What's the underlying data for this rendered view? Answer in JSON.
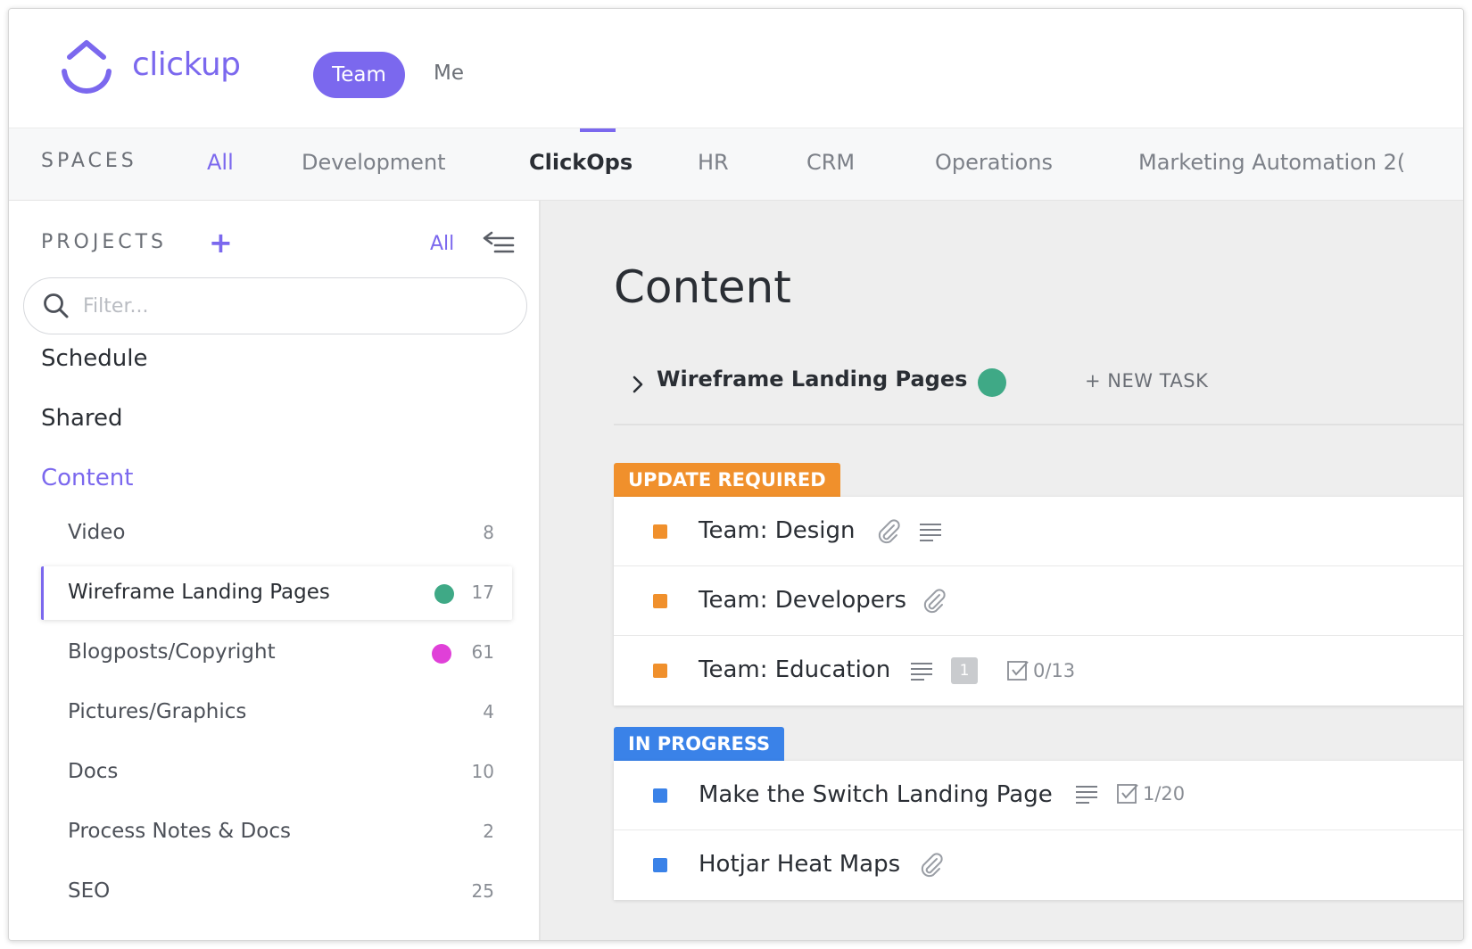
{
  "app": {
    "brand": "clickup"
  },
  "topbar": {
    "team_label": "Team",
    "me_label": "Me"
  },
  "spaces": {
    "label": "SPACES",
    "tabs": [
      {
        "label": "All"
      },
      {
        "label": "Development"
      },
      {
        "label": "ClickOps"
      },
      {
        "label": "HR"
      },
      {
        "label": "CRM"
      },
      {
        "label": "Operations"
      },
      {
        "label": "Marketing Automation 2("
      }
    ],
    "active": "ClickOps"
  },
  "sidebar": {
    "projects_label": "PROJECTS",
    "all_label": "All",
    "filter_placeholder": "Filter...",
    "nav": [
      {
        "label": "Schedule"
      },
      {
        "label": "Shared"
      },
      {
        "label": "Content"
      }
    ],
    "projects": [
      {
        "name": "Video",
        "count": "8"
      },
      {
        "name": "Wireframe Landing Pages",
        "count": "17",
        "dot_color": "#3fa986"
      },
      {
        "name": "Blogposts/Copyright",
        "count": "61",
        "dot_color": "#e040d8"
      },
      {
        "name": "Pictures/Graphics",
        "count": "4"
      },
      {
        "name": "Docs",
        "count": "10"
      },
      {
        "name": "Process Notes & Docs",
        "count": "2"
      },
      {
        "name": "SEO",
        "count": "25"
      }
    ]
  },
  "main": {
    "title": "Content",
    "list_title": "Wireframe Landing Pages",
    "list_dot_color": "#3fa986",
    "new_task_label": "+ NEW TASK",
    "groups": [
      {
        "status": "UPDATE REQUIRED",
        "color": "#f0902c",
        "tasks": [
          {
            "name": "Team: Design"
          },
          {
            "name": "Team: Developers"
          },
          {
            "name": "Team: Education",
            "badge": "1",
            "checklist": "0/13"
          }
        ]
      },
      {
        "status": "IN PROGRESS",
        "color": "#3a82e8",
        "tasks": [
          {
            "name": "Make the Switch Landing Page",
            "checklist": "1/20"
          },
          {
            "name": "Hotjar Heat Maps"
          }
        ]
      }
    ]
  }
}
